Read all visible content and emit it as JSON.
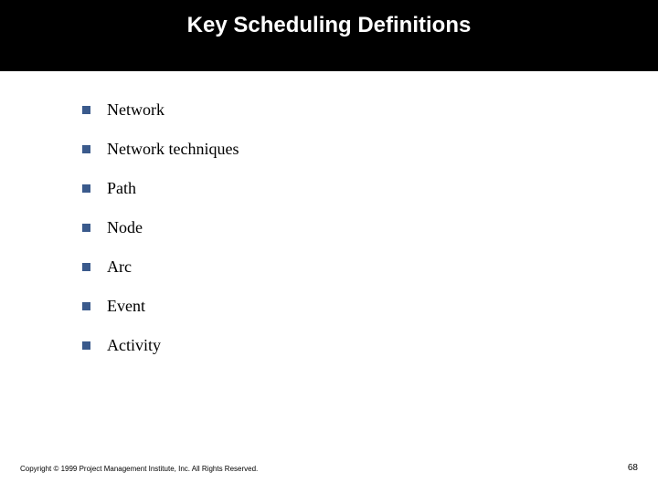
{
  "title": "Key Scheduling Definitions",
  "bullets": [
    "Network",
    "Network techniques",
    "Path",
    "Node",
    "Arc",
    "Event",
    "Activity"
  ],
  "footer": {
    "copyright": "Copyright © 1999 Project Management Institute, Inc. All Rights Reserved.",
    "page_number": "68"
  }
}
